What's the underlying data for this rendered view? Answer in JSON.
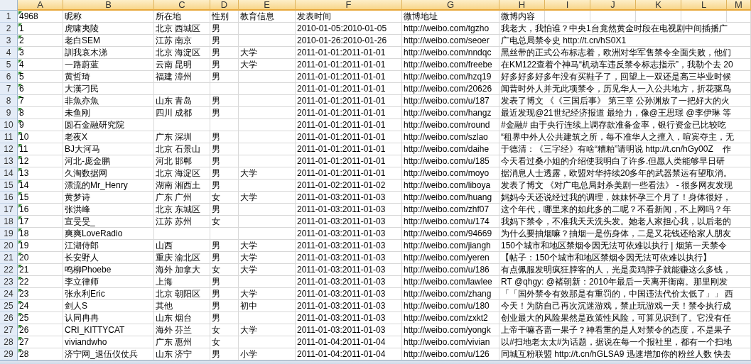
{
  "columns": [
    "A",
    "B",
    "C",
    "D",
    "E",
    "F",
    "G",
    "H",
    "I",
    "J",
    "K",
    "L",
    "M"
  ],
  "rows": [
    {
      "row": "1",
      "cells": [
        "4968",
        "昵称",
        "所在地",
        "性别",
        "教育信息",
        "发表时间",
        "微博地址",
        "微博内容"
      ]
    },
    {
      "row": "2",
      "cells": [
        "1",
        "虎啸夷陵",
        "北京 西城区",
        "男",
        "",
        "2010-01-05:2010-01-05",
        "http://weibo.com/tgzho",
        "我老大，我怕谁？中央1台竟然黄金时段在电视剧中间插播广"
      ]
    },
    {
      "row": "3",
      "cells": [
        "2",
        "老白SEM",
        "江苏 南京",
        "男",
        "",
        "2010-01-26:2010-01-26",
        "http://weibo.com/seoer",
        "广电总局禁令史 http://t.cn/hS0X1"
      ]
    },
    {
      "row": "4",
      "cells": [
        "3",
        "訓我哀木涕",
        "北京 海淀区",
        "男",
        "大学",
        "2011-01-01:2011-01-01",
        "http://weibo.com/nndqc",
        "黑丝带的正式公布标志着，欧洲对华军售禁令全面失败，他们"
      ]
    },
    {
      "row": "5",
      "cells": [
        "4",
        "一路蔚蓝",
        "云南 昆明",
        "男",
        "大学",
        "2011-01-01:2011-01-01",
        "http://weibo.com/freebe",
        "在KM122查着个神马“机动车违反禁令标志指示”，我勒个去 20"
      ]
    },
    {
      "row": "6",
      "cells": [
        "5",
        "黄哲琦",
        "福建 漳州",
        "男",
        "",
        "2011-01-01:2011-01-01",
        "http://weibo.com/hzq19",
        "好多好多好多年没有买鞋子了，回望上一双还是高三毕业时候"
      ]
    },
    {
      "row": "7",
      "cells": [
        "6",
        "大漢刁民",
        "",
        "",
        "",
        "2011-01-01:2011-01-01",
        "http://weibo.com/20626",
        "闻昔时外人并无此项禁令，历见华人一入公共地方，折花驱鸟"
      ]
    },
    {
      "row": "8",
      "cells": [
        "7",
        "非魚亦魚",
        "山东 青岛",
        "男",
        "",
        "2011-01-01:2011-01-01",
        "http://weibo.com/u/187",
        "发表了博文 《《三国后事》 第三章 公孙渊放了一把好大的火"
      ]
    },
    {
      "row": "9",
      "cells": [
        "8",
        "未鱼刚",
        "四川 成都",
        "男",
        "",
        "2011-01-01:2011-01-01",
        "http://weibo.com/hangz",
        "最近发现@21世纪经济报道 最给力，像@王思璟 @李伊琳 等"
      ]
    },
    {
      "row": "10",
      "cells": [
        "9",
        "圆石金融研究院",
        "",
        "",
        "",
        "2011-01-01:2011-01-01",
        "http://weibo.com/round",
        "#金融# 由于央行连续上调存款准备金率，银行资金已比较吃"
      ]
    },
    {
      "row": "11",
      "cells": [
        "10",
        "老夜X",
        "广东 深圳",
        "男",
        "",
        "2011-01-01:2011-01-01",
        "http://weibo.com/szlao",
        "“租界中外人公共建筑之所，每不准华人之擅入，喧宾夺主，无"
      ]
    },
    {
      "row": "12",
      "cells": [
        "11",
        "BJ大河马",
        "北京 石景山",
        "男",
        "",
        "2011-01-01:2011-01-01",
        "http://weibo.com/daihe",
        "于德清：《三字经》有啥“糟粕”请明说 http://t.cn/hGy00Z    作"
      ]
    },
    {
      "row": "13",
      "cells": [
        "12",
        "河北-庞金鹏",
        "河北 邯郸",
        "男",
        "",
        "2011-01-01:2011-01-01",
        "http://weibo.com/u/185",
        "今天看过桑小姐的介绍使我明白了许多.但愿人类能够早日研"
      ]
    },
    {
      "row": "14",
      "cells": [
        "13",
        "久淘数据网",
        "北京 海淀区",
        "男",
        "大学",
        "2011-01-01:2011-01-01",
        "http://weibo.com/moyo",
        "据消息人士透露，欧盟对华持续20多年的武器禁运有望取消。"
      ]
    },
    {
      "row": "15",
      "cells": [
        "14",
        "漂流的Mr_Henry",
        "湖南 湘西土",
        "男",
        "",
        "2011-01-02:2011-01-02",
        "http://weibo.com/liboya",
        "发表了博文 《对广电总局封杀美剧一些看法》 - 很多网友发现"
      ]
    },
    {
      "row": "16",
      "cells": [
        "15",
        "黄梦诗",
        "广东 广州",
        "女",
        "大学",
        "2011-01-03:2011-01-03",
        "http://weibo.com/huang",
        "妈妈今天还说经过我的调理，妹妹怀孕三个月了！身体很好，"
      ]
    },
    {
      "row": "17",
      "cells": [
        "16",
        "张洪峰",
        "北京 东城区",
        "男",
        "",
        "2011-01-03:2011-01-03",
        "http://weibo.com/zhf07",
        "这个年代，哪里来的如此多的二呢？不看新闻，不上网吗？年"
      ]
    },
    {
      "row": "18",
      "cells": [
        "17",
        "宣旻旻_",
        "江苏 苏州",
        "女",
        "",
        "2011-01-03:2011-01-03",
        "http://weibo.com/u/174",
        "我妈下禁令，不准我天天洗头发。她老人家担心我，以后老的"
      ]
    },
    {
      "row": "19",
      "cells": [
        "18",
        "爽爽LoveRadio",
        "",
        "",
        "",
        "2011-01-03:2011-01-03",
        "http://weibo.com/94669",
        "为什么要抽烟嘛？抽烟一是伤身体，二是又花钱还给家人朋友"
      ]
    },
    {
      "row": "20",
      "cells": [
        "19",
        "江湖侍郎",
        "山西",
        "男",
        "大学",
        "2011-01-03:2011-01-03",
        "http://weibo.com/jiangh",
        "150个城市和地区禁烟令因无法可依难以执行 | 烟第一天禁令"
      ]
    },
    {
      "row": "21",
      "cells": [
        "20",
        "长安野人",
        "重庆 渝北区",
        "男",
        "大学",
        "2011-01-03:2011-01-03",
        "http://weibo.com/yeren",
        "【帖子：150个城市和地区禁烟令因无法可依难以执行】"
      ]
    },
    {
      "row": "22",
      "cells": [
        "21",
        "鸣柳Phoebe",
        "海外 加拿大",
        "女",
        "大学",
        "2011-01-03:2011-01-03",
        "http://weibo.com/u/186",
        "有点佩服发明疯狂脖客的人，光是卖鸡脖子就能赚这么多钱，"
      ]
    },
    {
      "row": "23",
      "cells": [
        "22",
        "李立律师",
        "上海",
        "男",
        "",
        "2011-01-03:2011-01-03",
        "http://weibo.com/lawlee",
        "RT @qhgy: @褚朝新：2010年最后一天离开衡南。那里刚发"
      ]
    },
    {
      "row": "24",
      "cells": [
        "23",
        "张永利Eric",
        "北京 朝阳区",
        "男",
        "大学",
        "2011-01-03:2011-01-03",
        "http://weibo.com/zhang",
        "「「国外禁令有效那是有重罚的，中国违法代价太低了」」 西"
      ]
    },
    {
      "row": "25",
      "cells": [
        "24",
        "剑人S",
        "其他",
        "男",
        "初中",
        "2011-01-03:2011-01-03",
        "http://weibo.com/u/180",
        "今天！为防自己再次沉迷游戏，禁止玩游戏一天！禁令执行成"
      ]
    },
    {
      "row": "26",
      "cells": [
        "25",
        "认同冉冉",
        "山东 烟台",
        "男",
        "",
        "2011-01-03:2011-01-03",
        "http://weibo.com/zxkt2",
        "创业最大的风险果然是政策性风险，可算见识到了。它没有任"
      ]
    },
    {
      "row": "27",
      "cells": [
        "26",
        "CRI_KITTYCAT",
        "海外 芬兰",
        "女",
        "大学",
        "2011-01-03:2011-01-03",
        "http://weibo.com/yongk",
        "上帝干嘛吝啬一果子？神看重的是人对禁令的态度，不是果子"
      ]
    },
    {
      "row": "28",
      "cells": [
        "27",
        "viviandwho",
        "广东 惠州",
        "女",
        "",
        "2011-01-04:2011-01-04",
        "http://weibo.com/vivian",
        "以#扫地老太太#为话题，据说在每一个报社里，都有一个扫地"
      ]
    },
    {
      "row": "29",
      "cells": [
        "28",
        "济宁网_退伍仪仗兵",
        "山东 济宁",
        "男",
        "小学",
        "2011-01-04:2011-01-04",
        "http://weibo.com/u/126",
        "同城互粉联盟 http://t.cn/hGLSA9 迅速增加你的粉丝人数 快去"
      ]
    }
  ]
}
